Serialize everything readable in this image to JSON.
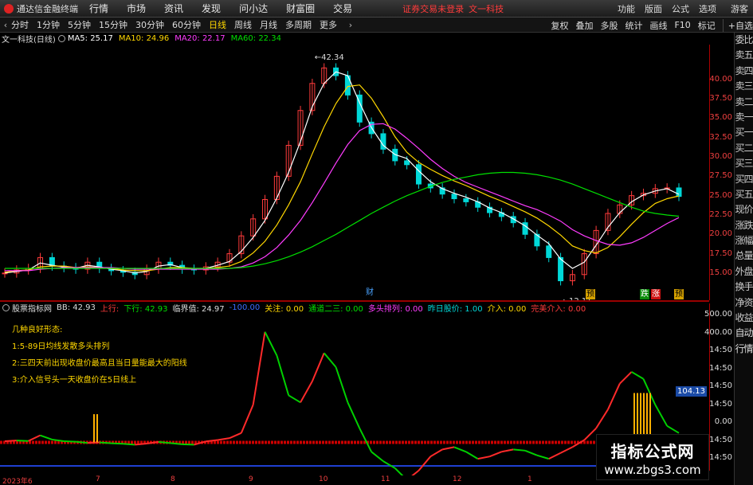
{
  "topbar": {
    "app_title": "通达信金融终端",
    "menu": [
      "行情",
      "市场",
      "资讯",
      "发现",
      "问小达",
      "财富圈",
      "交易"
    ],
    "login_notice": "证券交易未登录",
    "window_title": "文一科技",
    "tools": [
      "功能",
      "版面",
      "公式",
      "选项"
    ],
    "guest": "游客"
  },
  "periods": {
    "nav_left": "‹",
    "tabs": [
      "分时",
      "1分钟",
      "5分钟",
      "15分钟",
      "30分钟",
      "60分钟",
      "日线",
      "周线",
      "月线",
      "多周期",
      "更多"
    ],
    "active": "日线",
    "more_arrow": "›"
  },
  "right_tools": [
    "复权",
    "叠加",
    "多股",
    "统计",
    "画线",
    "F10",
    "标记",
    "+自选"
  ],
  "infobar": {
    "stock": "文一科技(日线)",
    "ma5": "MA5: 25.17",
    "ma10": "MA10: 24.96",
    "ma20": "MA20: 22.17",
    "ma60": "MA60: 22.34"
  },
  "colors": {
    "up": "#ff3b3b",
    "down": "#00d8d8",
    "ma5": "#ffffff",
    "ma10": "#ffd700",
    "ma20": "#ff3cff",
    "ma60": "#00e000",
    "panel_red": "#cc0000"
  },
  "main_axis": [
    "40.00",
    "37.50",
    "35.00",
    "32.50",
    "30.00",
    "27.50",
    "25.00",
    "22.50",
    "20.00",
    "17.50",
    "15.00"
  ],
  "price_labels": {
    "high": "42.34",
    "low": "12.11"
  },
  "chart_flags": [
    "财",
    "预",
    "跌",
    "涨",
    "预"
  ],
  "side_panel": [
    "委比",
    "卖五",
    "卖四",
    "卖三",
    "卖二",
    "卖一",
    "买一",
    "买二",
    "买三",
    "买四",
    "买五",
    "现价",
    "涨跌",
    "涨幅",
    "总量",
    "外盘",
    "换手",
    "净资",
    "收益",
    "自动",
    "行情"
  ],
  "ind_axis": [
    "500.00",
    "400.00",
    "14:50",
    "14:50",
    "14:50",
    "14:50",
    "0.00",
    "14:50",
    "14:50"
  ],
  "indbar": {
    "name": "股票指标网",
    "bb": "BB: 42.93",
    "shangxing": "上行:",
    "xiaxing": "下行: 42.93",
    "linjie": "临界值: 24.97",
    "blue_val": "-100.00",
    "guanzhu": "关注: 0.00",
    "tongdao": "通道二三: 0.00",
    "duotou": "多头排列: 0.00",
    "zuori": "昨日股价: 1.00",
    "jieru": "介入: 0.00",
    "wanmei": "完美介入: 0.00"
  },
  "notes": {
    "title": "几种良好形态:",
    "items": [
      "1:5-89日均线发散多头排列",
      "2:三四天前出现收盘价最高且当日量能最大的阳线",
      "3:介入信号头一天收盘价在5日线上"
    ]
  },
  "indicator_value": "104.13",
  "dates": [
    "2023年6",
    "7",
    "8",
    "9",
    "10",
    "11",
    "12",
    "1"
  ],
  "watermark": {
    "title": "指标公式网",
    "url": "www.zbgs3.com"
  },
  "chart_data": {
    "type": "line",
    "title": "文一科技(日线)",
    "ylim": [
      12,
      44
    ],
    "series": [
      {
        "name": "MA5",
        "values": [
          15.0,
          15.2,
          15.4,
          16.3,
          16.0,
          15.8,
          15.6,
          16.0,
          15.8,
          15.5,
          15.3,
          15.0,
          15.2,
          15.9,
          16.1,
          15.7,
          15.5,
          15.6,
          16.0,
          16.5,
          17.8,
          19.6,
          21.8,
          24.7,
          28.0,
          32.0,
          36.5,
          39.5,
          41.0,
          40.5,
          37.0,
          33.8,
          31.5,
          30.3,
          29.8,
          28.2,
          26.8,
          25.9,
          25.3,
          24.8,
          24.2,
          23.4,
          22.8,
          22.0,
          21.1,
          19.9,
          18.8,
          16.8,
          15.6,
          16.4,
          18.6,
          20.9,
          22.8,
          24.2,
          25.1,
          25.6,
          25.9,
          25.17
        ]
      },
      {
        "name": "MA10",
        "values": [
          15.1,
          15.3,
          15.4,
          15.8,
          15.9,
          15.9,
          15.7,
          15.8,
          15.7,
          15.6,
          15.4,
          15.3,
          15.3,
          15.5,
          15.7,
          15.7,
          15.6,
          15.6,
          15.7,
          15.9,
          16.5,
          17.6,
          19.1,
          21.2,
          23.8,
          26.8,
          30.4,
          33.9,
          36.9,
          39.1,
          39.3,
          37.6,
          35.2,
          32.6,
          30.6,
          29.3,
          28.4,
          27.6,
          26.9,
          26.3,
          25.6,
          24.9,
          24.3,
          23.6,
          22.9,
          22.1,
          21.1,
          19.9,
          18.5,
          17.9,
          17.6,
          18.3,
          19.7,
          21.3,
          22.8,
          24.0,
          24.6,
          24.96
        ]
      },
      {
        "name": "MA20",
        "values": [
          15.3,
          15.3,
          15.3,
          15.5,
          15.6,
          15.7,
          15.7,
          15.7,
          15.7,
          15.7,
          15.6,
          15.5,
          15.5,
          15.5,
          15.5,
          15.5,
          15.5,
          15.5,
          15.5,
          15.6,
          15.8,
          16.3,
          17.1,
          18.3,
          19.9,
          21.8,
          24.1,
          26.6,
          29.2,
          31.6,
          33.4,
          34.2,
          34.3,
          33.6,
          32.4,
          31.1,
          29.7,
          28.5,
          27.5,
          26.7,
          26.1,
          25.5,
          24.9,
          24.3,
          23.7,
          23.2,
          22.5,
          21.7,
          20.6,
          19.8,
          19.2,
          18.7,
          18.6,
          18.9,
          19.6,
          20.5,
          21.4,
          22.17
        ]
      },
      {
        "name": "MA60",
        "values": [
          15.6,
          15.6,
          15.6,
          15.6,
          15.6,
          15.6,
          15.6,
          15.6,
          15.6,
          15.6,
          15.6,
          15.6,
          15.6,
          15.6,
          15.6,
          15.6,
          15.6,
          15.6,
          15.6,
          15.6,
          15.7,
          15.9,
          16.2,
          16.6,
          17.1,
          17.7,
          18.4,
          19.2,
          20.0,
          20.9,
          21.8,
          22.7,
          23.5,
          24.3,
          25.0,
          25.6,
          26.2,
          26.7,
          27.1,
          27.4,
          27.7,
          27.9,
          28.0,
          28.0,
          27.9,
          27.7,
          27.4,
          27.0,
          26.5,
          25.9,
          25.3,
          24.7,
          24.1,
          23.5,
          23.0,
          22.7,
          22.5,
          22.34
        ]
      }
    ],
    "candles_close": [
      15.0,
      15.4,
      15.6,
      17.0,
      15.9,
      15.7,
      15.5,
      16.4,
      15.6,
      15.3,
      15.1,
      14.8,
      15.5,
      16.4,
      16.0,
      15.5,
      15.4,
      15.8,
      16.4,
      17.5,
      19.8,
      22.0,
      24.5,
      27.5,
      31.5,
      36.0,
      39.5,
      41.5,
      40.5,
      38.0,
      34.5,
      33.0,
      31.0,
      29.5,
      29.0,
      26.5,
      26.0,
      25.2,
      24.6,
      24.2,
      23.5,
      22.8,
      22.3,
      21.5,
      20.0,
      18.5,
      17.0,
      14.0,
      14.8,
      17.5,
      20.5,
      22.7,
      23.8,
      25.0,
      25.3,
      25.9,
      26.0,
      24.9
    ],
    "indicator": {
      "name": "股票指标网",
      "ylim": [
        -100,
        520
      ],
      "values": [
        5,
        8,
        6,
        30,
        12,
        5,
        3,
        -2,
        0,
        -4,
        -6,
        -10,
        -5,
        2,
        -3,
        -8,
        -10,
        4,
        10,
        18,
        40,
        160,
        470,
        370,
        200,
        170,
        260,
        380,
        320,
        170,
        60,
        -40,
        -80,
        -110,
        -160,
        -120,
        -60,
        -30,
        -20,
        -40,
        -70,
        -60,
        -40,
        -30,
        -35,
        -55,
        -70,
        -45,
        -20,
        10,
        60,
        140,
        250,
        300,
        270,
        160,
        70,
        40
      ]
    }
  }
}
